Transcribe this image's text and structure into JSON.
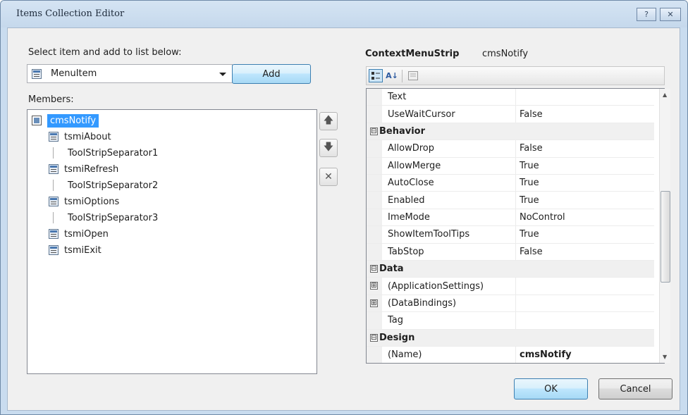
{
  "window": {
    "title": "Items Collection Editor",
    "help_glyph": "?",
    "close_glyph": "✕"
  },
  "left": {
    "select_label": "Select item and add to list below:",
    "combo_value": "MenuItem",
    "add_button": "Add",
    "members_label": "Members:",
    "members": [
      {
        "label": "cmsNotify",
        "kind": "root",
        "selected": true
      },
      {
        "label": "tsmiAbout",
        "kind": "item"
      },
      {
        "label": "ToolStripSeparator1",
        "kind": "separator"
      },
      {
        "label": "tsmiRefresh",
        "kind": "item"
      },
      {
        "label": "ToolStripSeparator2",
        "kind": "separator"
      },
      {
        "label": "tsmiOptions",
        "kind": "item"
      },
      {
        "label": "ToolStripSeparator3",
        "kind": "separator"
      },
      {
        "label": "tsmiOpen",
        "kind": "item"
      },
      {
        "label": "tsmiExit",
        "kind": "item"
      }
    ],
    "move_up_glyph": "🡅",
    "move_down_glyph": "🡇",
    "remove_glyph": "✕"
  },
  "right": {
    "object_type": "ContextMenuStrip",
    "object_name": "cmsNotify",
    "toolbar": {
      "sort_alpha_label": "A↓"
    },
    "rows": [
      {
        "type": "prop",
        "name": "Text",
        "value": ""
      },
      {
        "type": "prop",
        "name": "UseWaitCursor",
        "value": "False"
      },
      {
        "type": "cat",
        "name": "Behavior",
        "expander": "⊟"
      },
      {
        "type": "prop",
        "name": "AllowDrop",
        "value": "False"
      },
      {
        "type": "prop",
        "name": "AllowMerge",
        "value": "True"
      },
      {
        "type": "prop",
        "name": "AutoClose",
        "value": "True"
      },
      {
        "type": "prop",
        "name": "Enabled",
        "value": "True"
      },
      {
        "type": "prop",
        "name": "ImeMode",
        "value": "NoControl"
      },
      {
        "type": "prop",
        "name": "ShowItemToolTips",
        "value": "True"
      },
      {
        "type": "prop",
        "name": "TabStop",
        "value": "False"
      },
      {
        "type": "cat",
        "name": "Data",
        "expander": "⊟"
      },
      {
        "type": "prop",
        "name": "(ApplicationSettings)",
        "value": "",
        "expander": "⊞"
      },
      {
        "type": "prop",
        "name": "(DataBindings)",
        "value": "",
        "expander": "⊞"
      },
      {
        "type": "prop",
        "name": "Tag",
        "value": ""
      },
      {
        "type": "cat",
        "name": "Design",
        "expander": "⊟"
      },
      {
        "type": "prop",
        "name": "(Name)",
        "value": "cmsNotify",
        "bold": true
      }
    ]
  },
  "footer": {
    "ok": "OK",
    "cancel": "Cancel"
  },
  "colors": {
    "selection": "#3399ff",
    "title_bar": "#c9dcef"
  }
}
